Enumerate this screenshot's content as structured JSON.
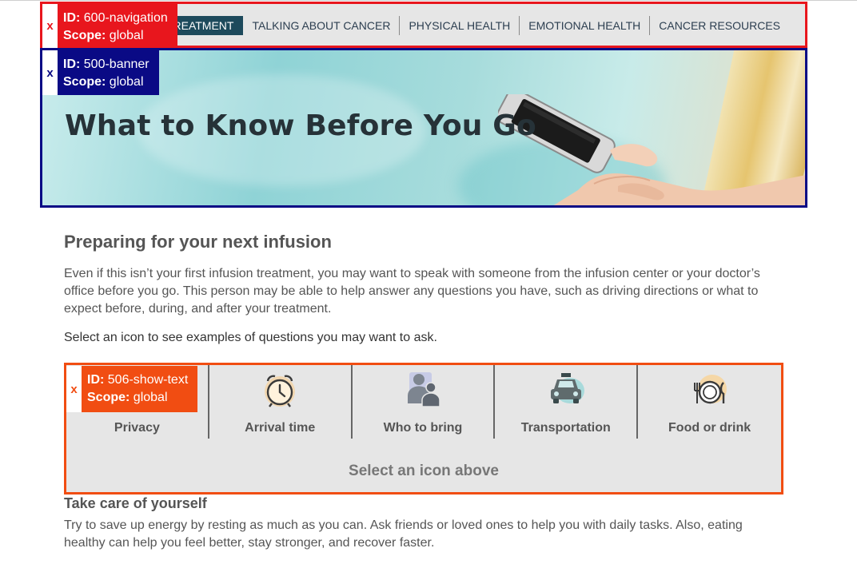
{
  "navigation": {
    "items": [
      {
        "label": "TREATMENT",
        "active": true
      },
      {
        "label": "TALKING ABOUT CANCER",
        "active": false
      },
      {
        "label": "PHYSICAL HEALTH",
        "active": false
      },
      {
        "label": "EMOTIONAL HEALTH",
        "active": false
      },
      {
        "label": "CANCER RESOURCES",
        "active": false
      }
    ]
  },
  "overlays": {
    "nav": {
      "close": "x",
      "id_label": "ID:",
      "id_value": "600-navigation",
      "scope_label": "Scope:",
      "scope_value": "global"
    },
    "banner": {
      "close": "x",
      "id_label": "ID:",
      "id_value": "500-banner",
      "scope_label": "Scope:",
      "scope_value": "global"
    },
    "show_text": {
      "close": "x",
      "id_label": "ID:",
      "id_value": "506-show-text",
      "scope_label": "Scope:",
      "scope_value": "global"
    }
  },
  "banner": {
    "title": "What to Know Before You Go"
  },
  "section": {
    "heading": "Preparing for your next infusion",
    "intro": "Even if this isn’t your first infusion treatment, you may want to speak with someone from the infusion center or your doctor’s office before you go. This person may be able to help answer any questions you have, such as driving directions or what to expect before, during, and after your treatment.",
    "instruction": "Select an icon to see examples of questions you may want to ask."
  },
  "icon_selector": {
    "items": [
      {
        "label": "Privacy",
        "icon": "lock-icon"
      },
      {
        "label": "Arrival time",
        "icon": "alarm-clock-icon"
      },
      {
        "label": "Who to bring",
        "icon": "people-icon"
      },
      {
        "label": "Transportation",
        "icon": "car-icon"
      },
      {
        "label": "Food or drink",
        "icon": "plate-utensils-icon"
      }
    ],
    "prompt": "Select an icon above"
  },
  "care": {
    "heading": "Take care of yourself",
    "text": "Try to save up energy by resting as much as you can. Ask friends or loved ones to help you with daily tasks. Also, eating healthy can help you feel better, stay stronger, and recover faster."
  },
  "colors": {
    "nav_active": "#1d4a5c",
    "overlay_red": "#e8161d",
    "overlay_blue": "#0a0a85",
    "overlay_orange": "#f14d12"
  }
}
